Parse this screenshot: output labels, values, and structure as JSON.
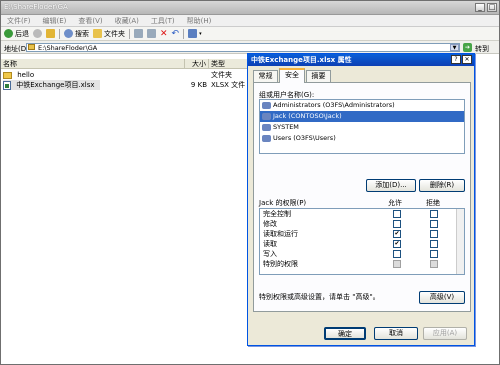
{
  "window": {
    "title": "E:\\ShareFloder\\GA"
  },
  "menu": [
    "文件(F)",
    "编辑(E)",
    "查看(V)",
    "收藏(A)",
    "工具(T)",
    "帮助(H)"
  ],
  "toolbar": {
    "back": "后退",
    "search": "搜索",
    "folders": "文件夹"
  },
  "address": {
    "label": "地址(D)",
    "value": "E:\\ShareFloder\\GA",
    "go": "转到"
  },
  "columns": {
    "name": "名称",
    "size": "大小",
    "type": "类型"
  },
  "files": [
    {
      "name": "hello",
      "size": "",
      "type": "文件夹"
    },
    {
      "name": "中铁Exchange项目.xlsx",
      "size": "9 KB",
      "type": "XLSX 文件"
    }
  ],
  "dialog": {
    "title": "中铁Exchange项目.xlsx 属性",
    "tabs": [
      "常规",
      "安全",
      "摘要"
    ],
    "group_label": "组或用户名称(G):",
    "users": [
      "Administrators (O3FS\\Administrators)",
      "Jack (CONTOSO\\Jack)",
      "SYSTEM",
      "Users (O3FS\\Users)"
    ],
    "add_button": "添加(D)...",
    "remove_button": "删除(R)",
    "perm_label": "Jack 的权限(P)",
    "allow_header": "允许",
    "deny_header": "拒绝",
    "permissions": [
      {
        "name": "完全控制",
        "allow": false,
        "deny": false
      },
      {
        "name": "修改",
        "allow": false,
        "deny": false
      },
      {
        "name": "读取和运行",
        "allow": true,
        "deny": false
      },
      {
        "name": "读取",
        "allow": true,
        "deny": false
      },
      {
        "name": "写入",
        "allow": false,
        "deny": false
      },
      {
        "name": "特别的权限",
        "allow": false,
        "deny": false
      }
    ],
    "advanced_text": "特别权限或高级设置，请单击 \"高级\"。",
    "advanced_button": "高级(V)",
    "ok_button": "确定",
    "cancel_button": "取消",
    "apply_button": "应用(A)"
  }
}
